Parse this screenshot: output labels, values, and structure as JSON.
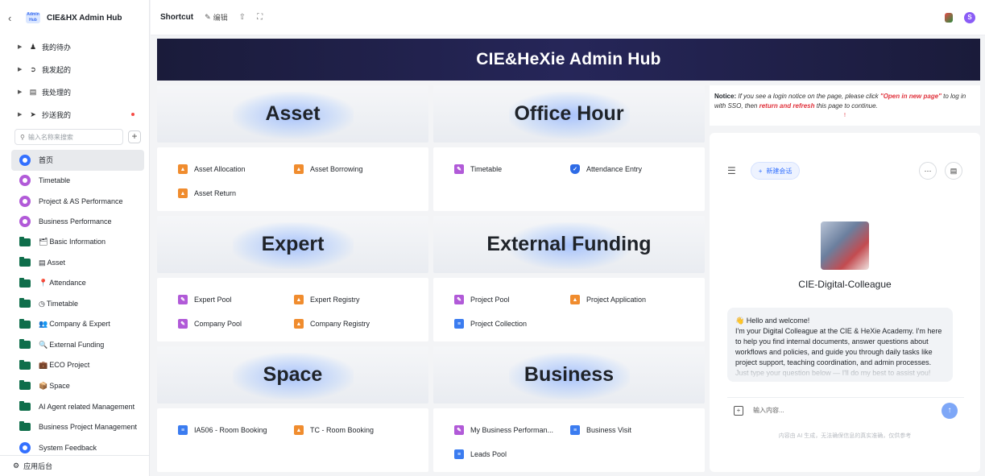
{
  "sidebar": {
    "back_icon": "chevron-left-icon",
    "app_logo_text": "Admin Hub",
    "app_title": "CIE&HX Admin Hub",
    "groups": [
      {
        "label": "我的待办",
        "icon": "person-icon",
        "badge": false
      },
      {
        "label": "我发起的",
        "icon": "send-circle-icon",
        "badge": false
      },
      {
        "label": "我处理的",
        "icon": "inbox-icon",
        "badge": false
      },
      {
        "label": "抄送我的",
        "icon": "paper-plane-icon",
        "badge": true
      }
    ],
    "search_placeholder": "输入名称来搜索",
    "items": [
      {
        "label": "首页",
        "kind": "circle",
        "color": "#3370ff",
        "emoji": ""
      },
      {
        "label": "Timetable",
        "kind": "circle",
        "color": "#b15ad8",
        "emoji": ""
      },
      {
        "label": "Project & AS Performance",
        "kind": "circle",
        "color": "#b15ad8",
        "emoji": ""
      },
      {
        "label": "Business Performance",
        "kind": "circle",
        "color": "#b15ad8",
        "emoji": ""
      },
      {
        "label": "Basic Information",
        "kind": "folder",
        "color": "#0f6e4b",
        "emoji": "🗂"
      },
      {
        "label": "Asset",
        "kind": "folder",
        "color": "#0f6e4b",
        "emoji": "▤"
      },
      {
        "label": "Attendance",
        "kind": "folder",
        "color": "#0f6e4b",
        "emoji": "📍"
      },
      {
        "label": "Timetable",
        "kind": "folder",
        "color": "#0f6e4b",
        "emoji": "◷"
      },
      {
        "label": "Company & Expert",
        "kind": "folder",
        "color": "#0f6e4b",
        "emoji": "👥"
      },
      {
        "label": "External Funding",
        "kind": "folder",
        "color": "#0f6e4b",
        "emoji": "🔍"
      },
      {
        "label": "ECO Project",
        "kind": "folder",
        "color": "#0f6e4b",
        "emoji": "💼"
      },
      {
        "label": "Space",
        "kind": "folder",
        "color": "#0f6e4b",
        "emoji": "📦"
      },
      {
        "label": "AI Agent related Management",
        "kind": "folder",
        "color": "#0f6e4b",
        "emoji": ""
      },
      {
        "label": "Business Project Management",
        "kind": "folder",
        "color": "#0f6e4b",
        "emoji": ""
      },
      {
        "label": "System Feedback",
        "kind": "circle",
        "color": "#3370ff",
        "emoji": ""
      }
    ],
    "footer": "应用后台"
  },
  "topbar": {
    "shortcut": "Shortcut",
    "edit": "编辑",
    "avatar_letter": "S"
  },
  "banner": {
    "title": "CIE&HeXie Admin Hub"
  },
  "cards": [
    {
      "title": "Asset",
      "links": [
        {
          "label": "Asset Allocation",
          "icon": "orange"
        },
        {
          "label": "Asset Borrowing",
          "icon": "orange"
        },
        {
          "label": "Asset Return",
          "icon": "orange"
        }
      ]
    },
    {
      "title": "Office Hour",
      "links": [
        {
          "label": "Timetable",
          "icon": "purple"
        },
        {
          "label": "Attendance Entry",
          "icon": "shield"
        }
      ]
    },
    {
      "title": "Expert",
      "links": [
        {
          "label": "Expert Pool",
          "icon": "purple"
        },
        {
          "label": "Expert Registry",
          "icon": "orange"
        },
        {
          "label": "Company Pool",
          "icon": "purple"
        },
        {
          "label": "Company Registry",
          "icon": "orange"
        }
      ]
    },
    {
      "title": "External Funding",
      "links": [
        {
          "label": "Project Pool",
          "icon": "purple"
        },
        {
          "label": "Project Application",
          "icon": "orange"
        },
        {
          "label": "Project Collection",
          "icon": "blue"
        }
      ]
    },
    {
      "title": "Space",
      "links": [
        {
          "label": "IA506 - Room Booking",
          "icon": "blue"
        },
        {
          "label": "TC - Room Booking",
          "icon": "orange"
        }
      ]
    },
    {
      "title": "Business",
      "links": [
        {
          "label": "My Business Performan...",
          "icon": "purple"
        },
        {
          "label": "Business Visit",
          "icon": "blue"
        },
        {
          "label": "Leads Pool",
          "icon": "blue"
        }
      ]
    }
  ],
  "notice": {
    "label": "Notice:",
    "t1": " If you see a login notice on the page, please click ",
    "link1": "\"Open in new page\"",
    "t2": " to log in with SSO, then ",
    "link2": "return and refresh",
    "t3": " this page to continue.",
    "mark": "!"
  },
  "chat": {
    "new_session": "新建会话",
    "bot_name": "CIE-Digital-Colleague",
    "greeting": "Hello and welcome!",
    "message": "I'm your Digital Colleague at the CIE & HeXie Academy. I'm here to help you find internal documents, answer questions about workflows and policies, and guide you through daily tasks like project support, teaching coordination, and admin processes.",
    "message_tail": "Just type your question below — I'll do my best to assist you!",
    "input_placeholder": "输入内容...",
    "disclaimer": "内容由 AI 生成，无法确保信息的真实准确，仅供参考"
  }
}
